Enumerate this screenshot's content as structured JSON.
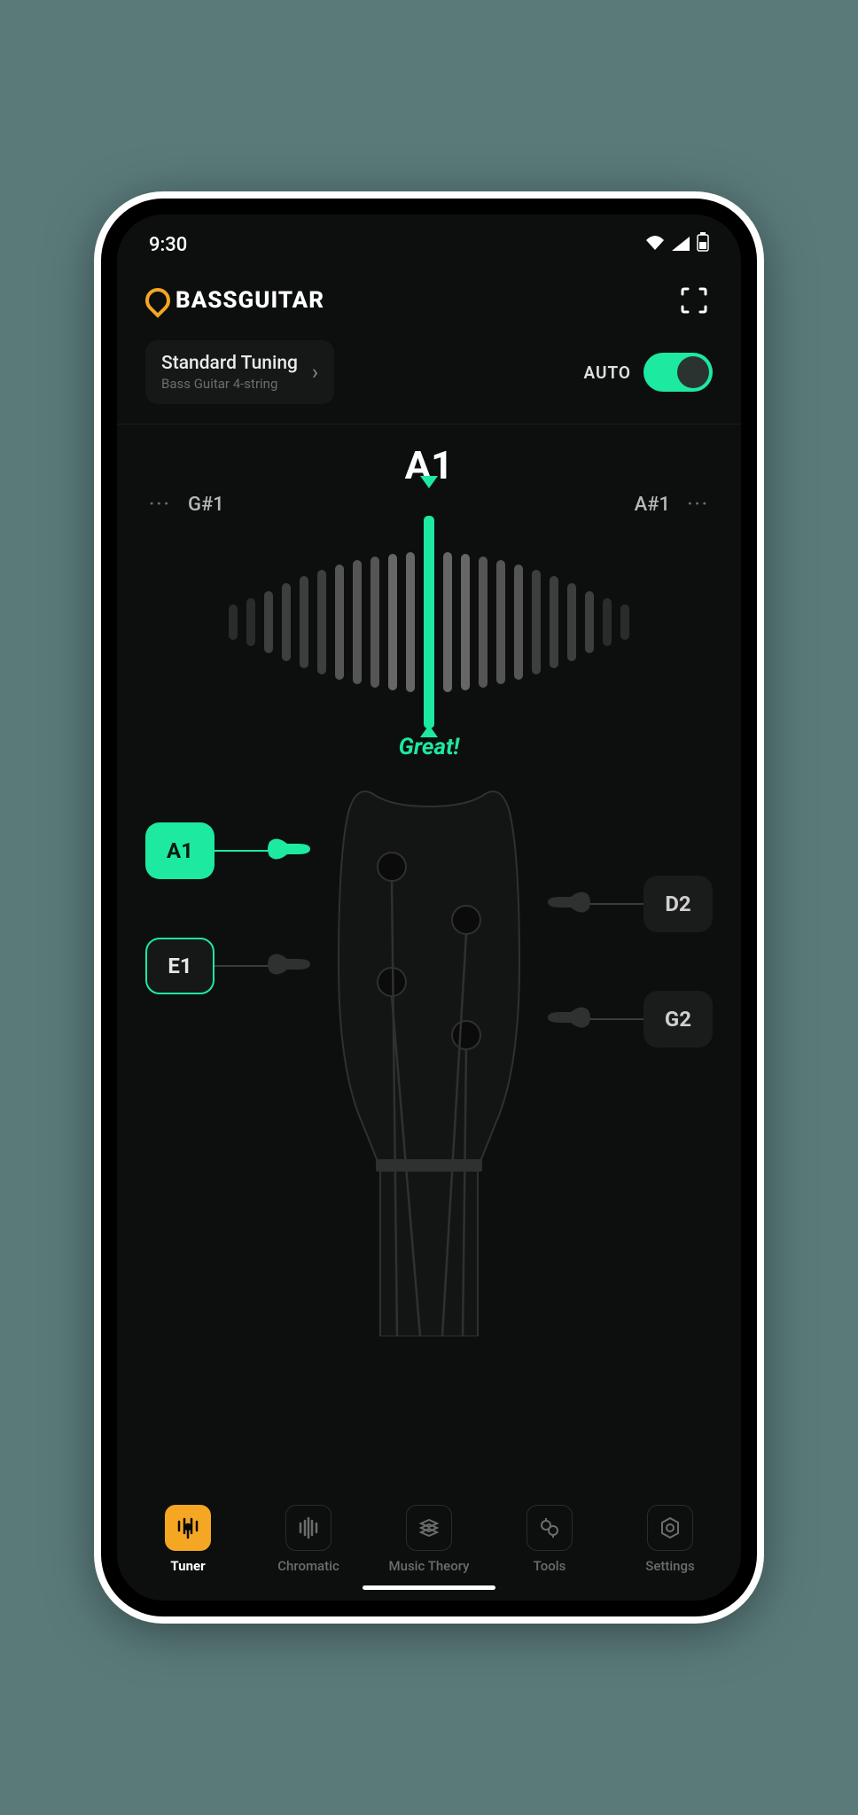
{
  "status_bar": {
    "time": "9:30"
  },
  "header": {
    "brand": "BASSGUITAR"
  },
  "tuning": {
    "title": "Standard Tuning",
    "subtitle": "Bass Guitar 4-string",
    "auto_label": "AUTO",
    "auto_enabled": true
  },
  "meter": {
    "current_note": "A1",
    "prev_note": "G#1",
    "next_note": "A#1",
    "status_text": "Great!",
    "ellipsis": "···"
  },
  "strings": {
    "a1": "A1",
    "e1": "E1",
    "d2": "D2",
    "g2": "G2"
  },
  "nav": {
    "tuner": "Tuner",
    "chromatic": "Chromatic",
    "music_theory": "Music Theory",
    "tools": "Tools",
    "settings": "Settings"
  }
}
